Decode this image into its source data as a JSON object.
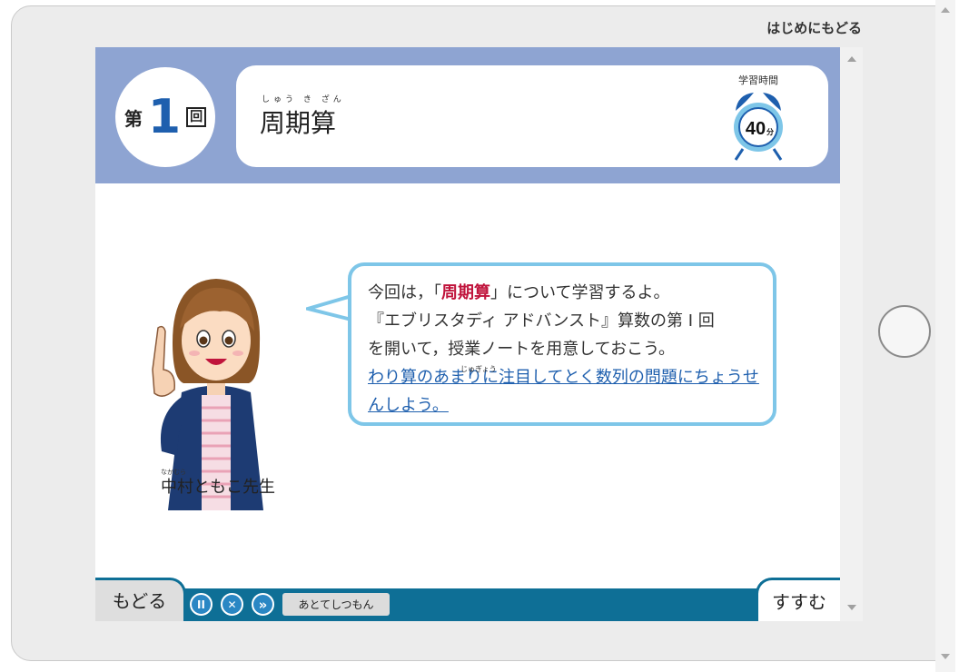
{
  "top": {
    "back_to_start": "はじめにもどる"
  },
  "header": {
    "lesson_prefix": "第",
    "lesson_number": "1",
    "lesson_suffix": "回",
    "title_ruby": "しゅう き ざん",
    "title": "周期算",
    "clock_label": "学習時間",
    "clock_minutes": "40",
    "clock_unit": "分"
  },
  "teacher": {
    "name_ruby": "なかむら",
    "name": "中村ともこ先生"
  },
  "bubble": {
    "line1_pre": "今回は，「",
    "line1_highlight": "周期算",
    "line1_post": "」について学習するよ。",
    "line2": "『エブリスタディ アドバンスト』算数の第 Ⅰ 回",
    "line3": "を開いて，授業ノートを用意しておこう。",
    "line3_ruby": "じゅぎょう",
    "link": "わり算のあまりに注目してとく数列の問題にちょうせんしよう。"
  },
  "bottom": {
    "back_label": "もどる",
    "next_label": "すすむ",
    "ask_later_label": "あとてしつもん",
    "pause_glyph": "II",
    "close_glyph": "✕",
    "skip_glyph": "»"
  },
  "colors": {
    "header_bg": "#8ea4d2",
    "lesson_number": "#1e5fae",
    "highlight": "#c0143c",
    "bubble_border": "#7ec6e8",
    "bar": "#0e6f96",
    "control": "#2a87c4"
  }
}
